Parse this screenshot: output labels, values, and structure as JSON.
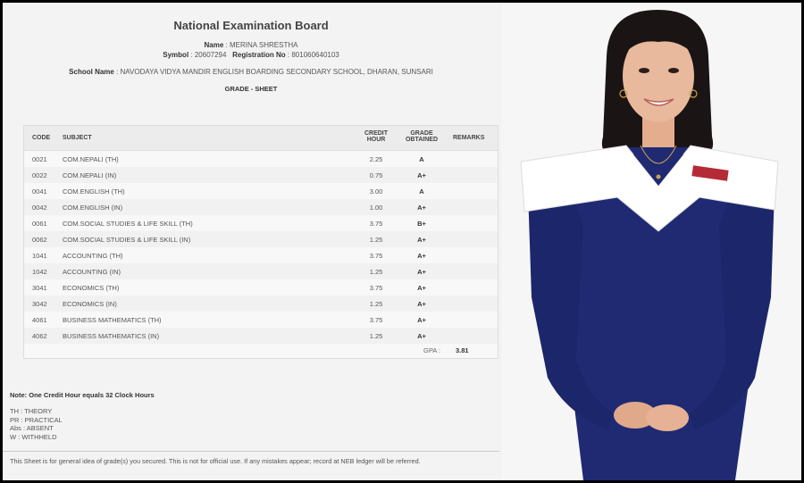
{
  "header": {
    "board": "National Examination Board",
    "name_label": "Name",
    "name": "MERINA SHRESTHA",
    "symbol_label": "Symbol",
    "symbol": "20607294",
    "registration_label": "Registration No",
    "registration": "801060640103",
    "school_label": "School Name",
    "school": "NAVODAYA VIDYA MANDIR ENGLISH BOARDING SECONDARY SCHOOL, DHARAN, SUNSARI",
    "sheet_title": "GRADE - SHEET"
  },
  "table": {
    "columns": {
      "code": "CODE",
      "subject": "SUBJECT",
      "credit_1": "CREDIT",
      "credit_2": "HOUR",
      "grade_1": "GRADE",
      "grade_2": "OBTAINED",
      "remarks": "REMARKS"
    },
    "rows": [
      {
        "code": "0021",
        "subject": "COM.NEPALI (TH)",
        "credit": "2.25",
        "grade": "A"
      },
      {
        "code": "0022",
        "subject": "COM.NEPALI (IN)",
        "credit": "0.75",
        "grade": "A+"
      },
      {
        "code": "0041",
        "subject": "COM.ENGLISH (TH)",
        "credit": "3.00",
        "grade": "A"
      },
      {
        "code": "0042",
        "subject": "COM.ENGLISH (IN)",
        "credit": "1.00",
        "grade": "A+"
      },
      {
        "code": "0061",
        "subject": "COM.SOCIAL STUDIES & LIFE SKILL (TH)",
        "credit": "3.75",
        "grade": "B+"
      },
      {
        "code": "0062",
        "subject": "COM.SOCIAL STUDIES & LIFE SKILL (IN)",
        "credit": "1.25",
        "grade": "A+"
      },
      {
        "code": "1041",
        "subject": "ACCOUNTING (TH)",
        "credit": "3.75",
        "grade": "A+"
      },
      {
        "code": "1042",
        "subject": "ACCOUNTING (IN)",
        "credit": "1.25",
        "grade": "A+"
      },
      {
        "code": "3041",
        "subject": "ECONOMICS (TH)",
        "credit": "3.75",
        "grade": "A+"
      },
      {
        "code": "3042",
        "subject": "ECONOMICS (IN)",
        "credit": "1.25",
        "grade": "A+"
      },
      {
        "code": "4061",
        "subject": "BUSINESS MATHEMATICS (TH)",
        "credit": "3.75",
        "grade": "A+"
      },
      {
        "code": "4062",
        "subject": "BUSINESS MATHEMATICS (IN)",
        "credit": "1.25",
        "grade": "A+"
      }
    ],
    "gpa_label": "GPA :",
    "gpa": "3.81"
  },
  "footer": {
    "note": "Note: One Credit Hour equals 32 Clock Hours",
    "legend": [
      "TH : THEORY",
      "PR : PRACTICAL",
      "Abs : ABSENT",
      "W : WITHHELD"
    ],
    "disclaimer": "This Sheet is for general idea of grade(s) you secured. This is not for official use. If any mistakes appear; record at NEB ledger will be referred."
  },
  "colors": {
    "frame": "#000000",
    "sheet_bg": "#f3f3f3",
    "uniform": "#1f2a73",
    "collar": "#ffffff",
    "hair": "#1a1414",
    "skin": "#e8b99c"
  }
}
